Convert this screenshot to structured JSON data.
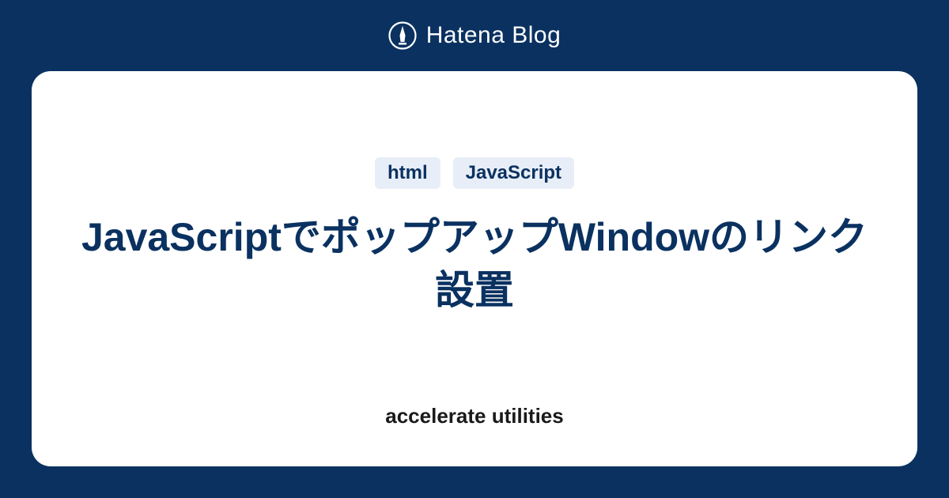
{
  "header": {
    "brand_text": "Hatena Blog"
  },
  "card": {
    "tags": [
      "html",
      "JavaScript"
    ],
    "title": "JavaScriptでポップアップWindowのリンク設置",
    "subtitle": "accelerate utilities"
  },
  "colors": {
    "background": "#0a3160",
    "card_background": "#ffffff",
    "tag_background": "#e8eef7",
    "title_color": "#0a3160"
  }
}
